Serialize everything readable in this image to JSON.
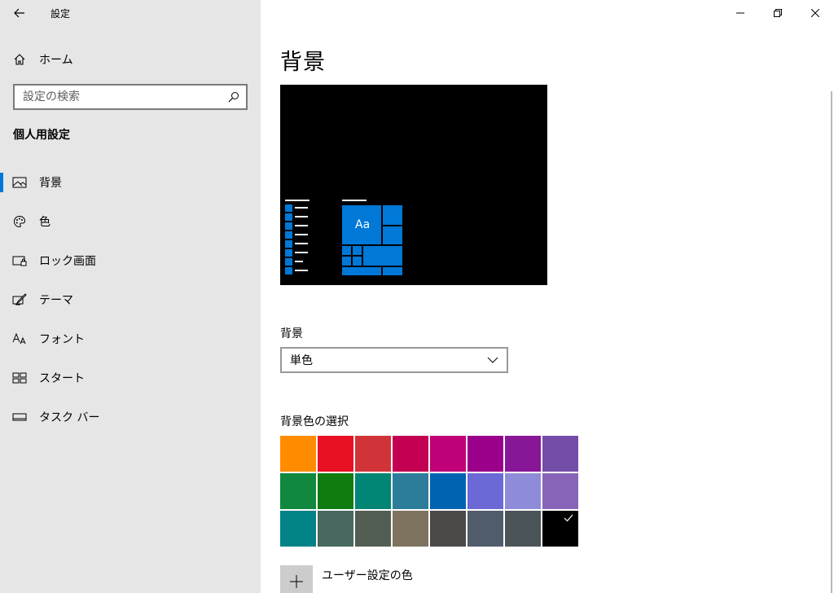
{
  "window": {
    "title": "設定",
    "controls": [
      "minimize-icon",
      "restore-icon",
      "close-icon"
    ]
  },
  "sidebar": {
    "home_label": "ホーム",
    "search_placeholder": "設定の検索",
    "section_title": "個人用設定",
    "items": [
      {
        "label": "背景",
        "icon": "picture-icon",
        "active": true
      },
      {
        "label": "色",
        "icon": "palette-icon",
        "active": false
      },
      {
        "label": "ロック画面",
        "icon": "lock-screen-icon",
        "active": false
      },
      {
        "label": "テーマ",
        "icon": "theme-icon",
        "active": false
      },
      {
        "label": "フォント",
        "icon": "font-icon",
        "active": false
      },
      {
        "label": "スタート",
        "icon": "start-icon",
        "active": false
      },
      {
        "label": "タスク バー",
        "icon": "taskbar-icon",
        "active": false
      }
    ]
  },
  "main": {
    "title": "背景",
    "preview": {
      "sample_text": "Aa",
      "accent": "#0078d7"
    },
    "background_label": "背景",
    "background_value": "単色",
    "color_label": "背景色の選択",
    "selected_color": "#000000",
    "colors": [
      "#ff8c00",
      "#e81123",
      "#d13438",
      "#c30052",
      "#bf0077",
      "#9a0089",
      "#881798",
      "#744da9",
      "#10893e",
      "#107c10",
      "#018574",
      "#2d7d9a",
      "#0063b1",
      "#6b69d6",
      "#8e8cd8",
      "#8764b8",
      "#038387",
      "#486860",
      "#525e54",
      "#7e735f",
      "#4c4a48",
      "#515c6b",
      "#4a5459",
      "#000000"
    ],
    "custom_color_label": "ユーザー設定の色"
  }
}
